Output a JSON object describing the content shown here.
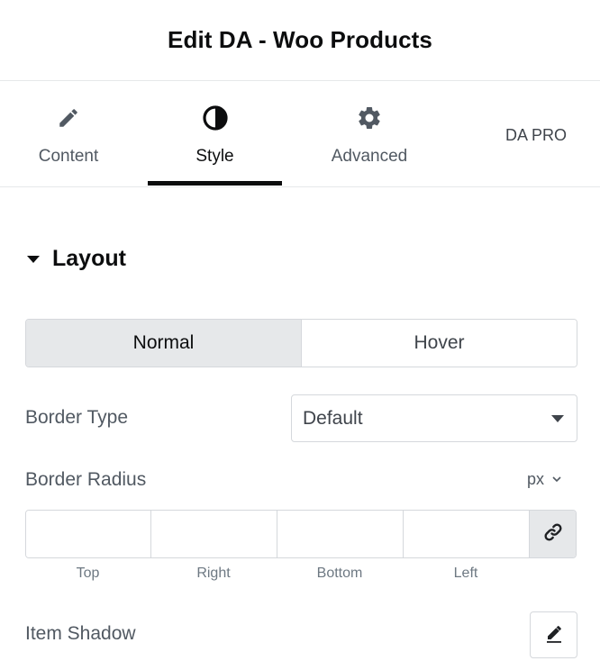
{
  "header": {
    "title": "Edit DA - Woo Products"
  },
  "tabs": [
    {
      "label": "Content",
      "icon": "pencil-icon",
      "active": false
    },
    {
      "label": "Style",
      "icon": "half-circle-icon",
      "active": true
    },
    {
      "label": "Advanced",
      "icon": "gear-icon",
      "active": false
    },
    {
      "label": "DA PRO",
      "icon": "",
      "active": false
    }
  ],
  "section": {
    "title": "Layout"
  },
  "state_toggle": {
    "normal_label": "Normal",
    "hover_label": "Hover",
    "selected": "Normal"
  },
  "border_type": {
    "label": "Border Type",
    "value": "Default"
  },
  "border_radius": {
    "label": "Border Radius",
    "unit": "px",
    "fields": [
      {
        "label": "Top",
        "value": ""
      },
      {
        "label": "Right",
        "value": ""
      },
      {
        "label": "Bottom",
        "value": ""
      },
      {
        "label": "Left",
        "value": ""
      }
    ]
  },
  "item_shadow": {
    "label": "Item Shadow"
  },
  "colors": {
    "text_dark": "#0c0d0e",
    "text_muted": "#515962",
    "border": "#d5d8dc",
    "active_bg": "#e6e8ea"
  }
}
